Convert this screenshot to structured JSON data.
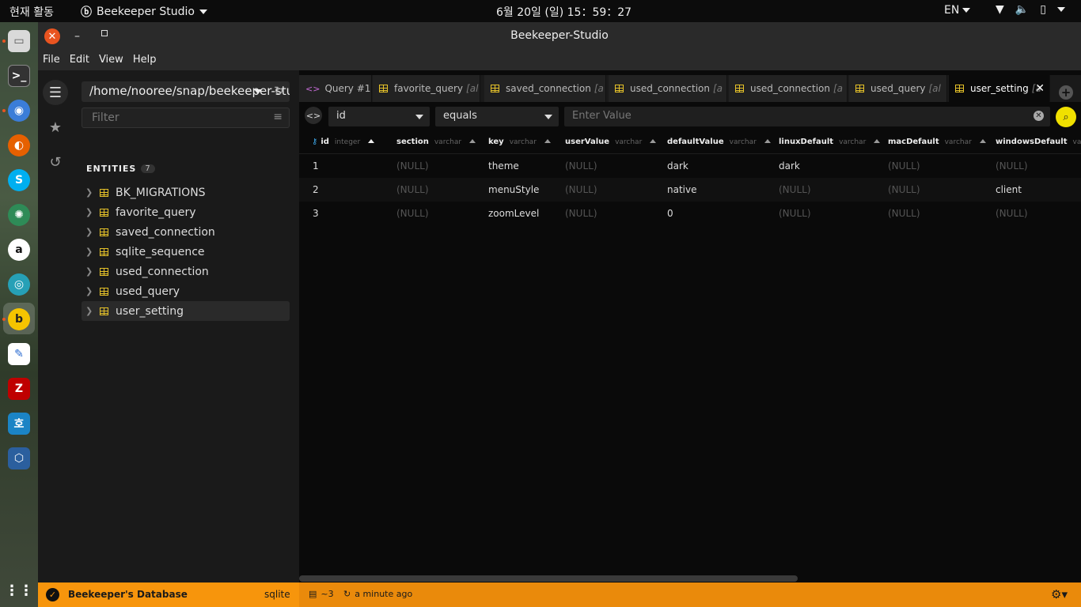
{
  "topbar": {
    "activities": "현재 활동",
    "app_menu": "Beekeeper Studio",
    "clock": "6월 20일 (일)  15：59：27",
    "lang": "EN"
  },
  "window": {
    "title": "Beekeeper-Studio",
    "menu": [
      "File",
      "Edit",
      "View",
      "Help"
    ]
  },
  "sidebar": {
    "connection_path": "/home/nooree/snap/beekeeper-studio",
    "filter_placeholder": "Filter",
    "entities_label": "ENTITIES",
    "entities_count": "7",
    "entities": [
      "BK_MIGRATIONS",
      "favorite_query",
      "saved_connection",
      "sqlite_sequence",
      "used_connection",
      "used_query",
      "user_setting"
    ],
    "selected": "user_setting"
  },
  "tabs": [
    {
      "label": "Query #1",
      "type": "query",
      "suffix": ""
    },
    {
      "label": "favorite_query",
      "type": "table",
      "suffix": "[al"
    },
    {
      "label": "saved_connection",
      "type": "table",
      "suffix": "[a"
    },
    {
      "label": "used_connection",
      "type": "table",
      "suffix": "[a"
    },
    {
      "label": "used_connection",
      "type": "table",
      "suffix": "[a"
    },
    {
      "label": "used_query",
      "type": "table",
      "suffix": "[al"
    },
    {
      "label": "user_setting",
      "type": "table",
      "suffix": "[a",
      "active": true
    }
  ],
  "filter": {
    "field": "id",
    "operator": "equals",
    "value_placeholder": "Enter Value"
  },
  "table": {
    "columns": [
      {
        "name": "id",
        "type": "integer",
        "key": true
      },
      {
        "name": "section",
        "type": "varchar"
      },
      {
        "name": "key",
        "type": "varchar"
      },
      {
        "name": "userValue",
        "type": "varchar"
      },
      {
        "name": "defaultValue",
        "type": "varchar"
      },
      {
        "name": "linuxDefault",
        "type": "varchar"
      },
      {
        "name": "macDefault",
        "type": "varchar"
      },
      {
        "name": "windowsDefault",
        "type": "varchar"
      }
    ],
    "rows": [
      [
        "1",
        "(NULL)",
        "theme",
        "(NULL)",
        "dark",
        "dark",
        "(NULL)",
        "(NULL)"
      ],
      [
        "2",
        "(NULL)",
        "menuStyle",
        "(NULL)",
        "native",
        "(NULL)",
        "(NULL)",
        "client"
      ],
      [
        "3",
        "(NULL)",
        "zoomLevel",
        "(NULL)",
        "0",
        "(NULL)",
        "(NULL)",
        "(NULL)"
      ]
    ]
  },
  "status": {
    "db_name": "Beekeeper's Database",
    "db_type": "sqlite",
    "rows": "~3",
    "updated": "a minute ago"
  },
  "colors": {
    "accent": "#f7950c",
    "table_icon": "#e6c229",
    "search_button": "#f0e000"
  }
}
